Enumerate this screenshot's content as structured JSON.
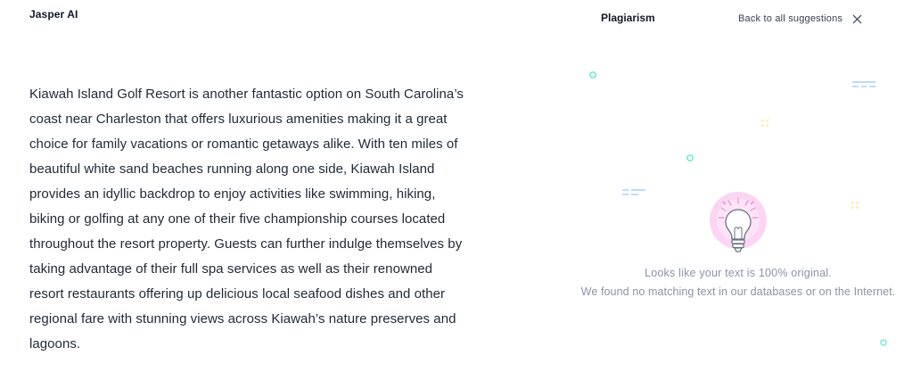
{
  "app": {
    "title": "Jasper AI"
  },
  "editor": {
    "lines": [
      "Kiawah Island Golf Resort is another fantastic option on South Carolina’s",
      "coast near Charleston that offers luxurious amenities making it a great",
      "choice for family vacations or romantic getaways alike. With ten miles of",
      "beautiful white sand beaches running along one side, Kiawah Island",
      "provides an idyllic backdrop to enjoy activities like swimming, hiking,",
      "biking or golfing at any one of their five championship courses located",
      "throughout the resort property. Guests can further indulge themselves by",
      "taking advantage of their full spa services as well as their renowned",
      "resort restaurants offering up delicious local seafood dishes and other",
      "regional fare with stunning views across Kiawah’s nature preserves and",
      "lagoons."
    ]
  },
  "panel": {
    "title": "Plagiarism",
    "back_label": "Back to all suggestions",
    "close_icon": "close-icon",
    "illustration_icon": "lightbulb-icon",
    "message_primary": "Looks like your text is 100% original.",
    "message_secondary": "We found no matching text in our databases or on the Internet."
  },
  "colors": {
    "accent_pink": "#f9d0f0",
    "accent_teal": "#5eead4",
    "accent_blue": "#93c5fd",
    "accent_yellow": "#fde68a",
    "muted_text": "#8b93a7"
  }
}
